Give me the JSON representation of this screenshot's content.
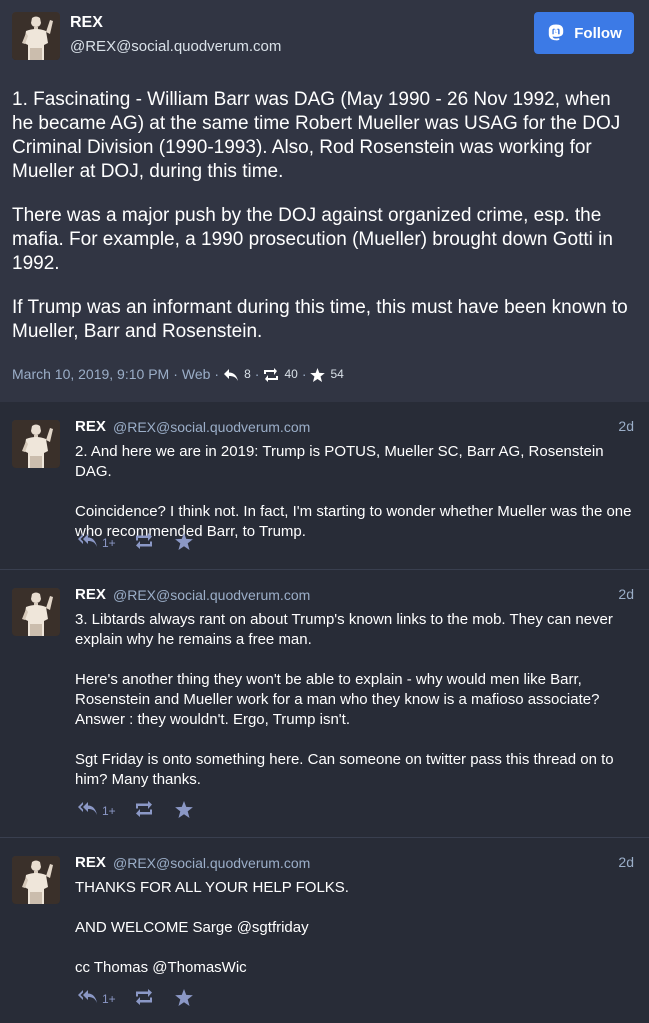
{
  "main_post": {
    "author_name": "REX",
    "author_handle": "@REX@social.quodverum.com",
    "follow_label": "Follow",
    "paragraphs": [
      "1. Fascinating - William Barr was DAG (May 1990 - 26 Nov 1992, when he became AG) at the same time Robert Mueller was USAG for the DOJ Criminal Division (1990-1993). Also, Rod Rosenstein was working for Mueller at DOJ, during this time.",
      "There was a major push by the DOJ against organized crime, esp. the mafia. For example, a 1990 prosecution (Mueller) brought down Gotti in 1992.",
      "If Trump was an informant during this time, this must have been known to Mueller, Barr and Rosenstein."
    ],
    "timestamp": "March 10, 2019, 9:10 PM",
    "separator": "·",
    "client": "Web",
    "reply_count": "8",
    "boost_count": "40",
    "fav_count": "54"
  },
  "replies": [
    {
      "author_name": "REX",
      "author_handle": "@REX@social.quodverum.com",
      "time": "2d",
      "paragraphs": [
        "2. And here we are in 2019: Trump is POTUS, Mueller SC, Barr AG, Rosenstein DAG.",
        "Coincidence? I think not. In fact, I'm starting to wonder whether Mueller was the one who recommended Barr, to Trump."
      ],
      "reply_count": "1+"
    },
    {
      "author_name": "REX",
      "author_handle": "@REX@social.quodverum.com",
      "time": "2d",
      "paragraphs": [
        "3. Libtards always rant on about Trump's known links to the mob. They can never explain why he remains a free man.",
        "Here's another thing they won't be able to explain - why would men like Barr, Rosenstein and Mueller work for a man who they know is a mafioso associate? Answer : they wouldn't. Ergo, Trump isn't.",
        "Sgt Friday is onto something here. Can someone on twitter pass this thread on to him? Many thanks."
      ],
      "reply_count": "1+"
    },
    {
      "author_name": "REX",
      "author_handle": "@REX@social.quodverum.com",
      "time": "2d",
      "paragraphs": [
        "THANKS FOR ALL YOUR HELP FOLKS.",
        "AND WELCOME Sarge @sgtfriday",
        "cc Thomas @ThomasWic"
      ],
      "reply_count": "1+"
    }
  ],
  "icons": {
    "follow": "mastodon-logo-icon",
    "reply": "reply-icon",
    "reply_all": "reply-all-icon",
    "boost": "boost-icon",
    "favourite": "star-icon"
  },
  "colors": {
    "background": "#282c37",
    "main_post_background": "#313543",
    "accent": "#3c7ae6",
    "secondary_text": "#9baec8",
    "action_icon": "#8b98c6"
  }
}
